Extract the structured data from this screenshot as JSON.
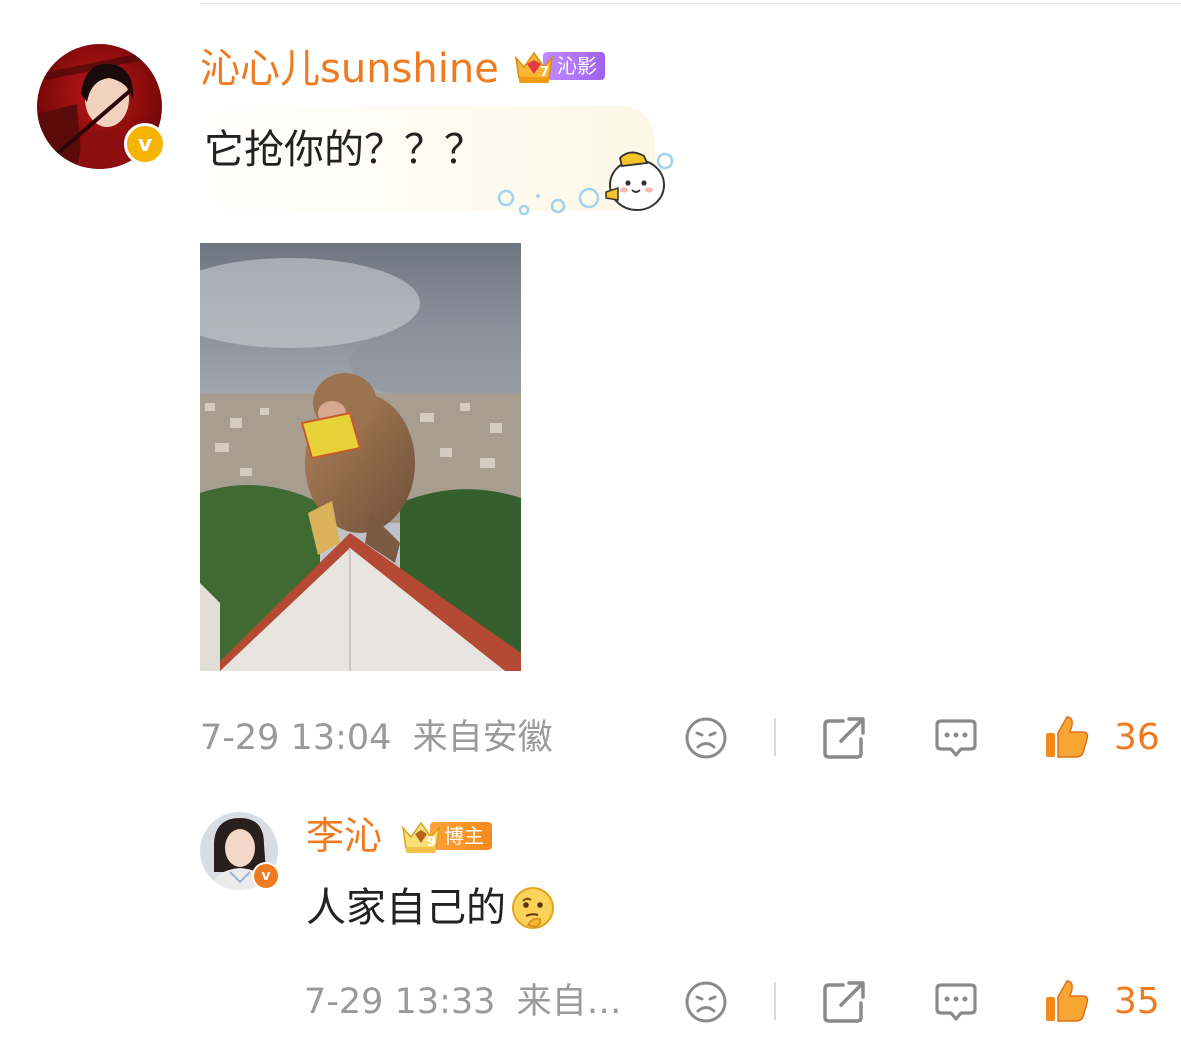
{
  "comments": [
    {
      "username": "沁心儿sunshine",
      "badge_label": "沁影",
      "crown_level": "7",
      "text": "它抢你的？？？",
      "time": "7-29 13:04",
      "location": "来自安徽",
      "likes": "36",
      "verified_mark": "v",
      "sticker_icon": "bubble-mascot-icon",
      "image_icon": "monkey-photo"
    },
    {
      "username": "李沁",
      "badge_label": "博主",
      "crown_level": "9",
      "text": "人家自己的",
      "emoji_icon": "thinking-face-icon",
      "time": "7-29 13:33",
      "location": "来自…",
      "likes": "35",
      "verified_mark": "v"
    }
  ],
  "actions": {
    "dislike_icon": "frown-face-icon",
    "share_icon": "share-icon",
    "reply_icon": "comment-icon",
    "like_icon": "thumbs-up-icon"
  },
  "colors": {
    "accent": "#f07a1f",
    "meta_gray": "#9a9a9a",
    "icon_gray": "#8a8a8a",
    "verified_yellow": "#f5b400",
    "verified_orange": "#f07a1f",
    "badge_purple": "#a86cf0",
    "badge_orange": "#f58a1c"
  }
}
